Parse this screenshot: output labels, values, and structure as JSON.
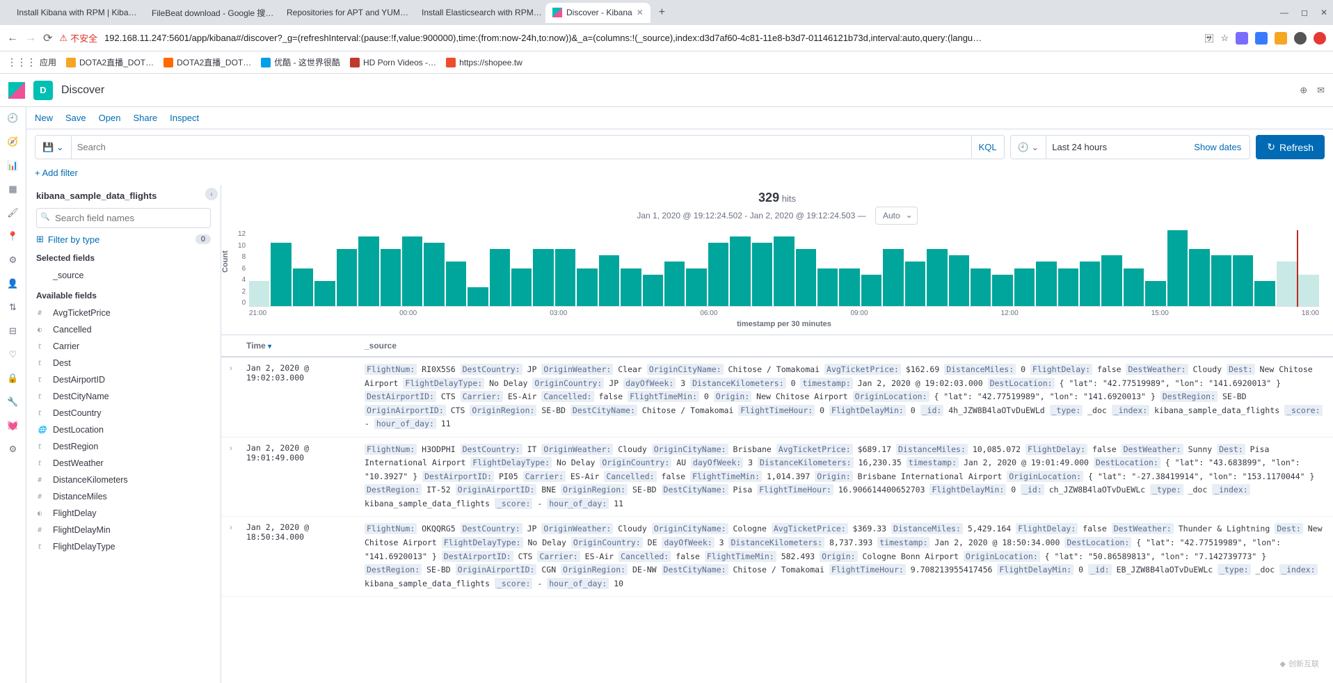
{
  "browser": {
    "tabs": [
      {
        "title": "Install Kibana with RPM | Kiba…",
        "active": false,
        "icon": "elastic"
      },
      {
        "title": "FileBeat download - Google 搜…",
        "active": false,
        "icon": "google"
      },
      {
        "title": "Repositories for APT and YUM…",
        "active": false,
        "icon": "elastic"
      },
      {
        "title": "Install Elasticsearch with RPM…",
        "active": false,
        "icon": "elastic"
      },
      {
        "title": "Discover - Kibana",
        "active": true,
        "icon": "kibana"
      }
    ],
    "url_warn": "不安全",
    "url": "192.168.11.247:5601/app/kibana#/discover?_g=(refreshInterval:(pause:!f,value:900000),time:(from:now-24h,to:now))&_a=(columns:!(_source),index:d3d7af60-4c81-11e8-b3d7-01146121b73d,interval:auto,query:(langu…",
    "bookmarks": [
      {
        "label": "应用",
        "fav": "#5f6368"
      },
      {
        "label": "DOTA2直播_DOT…",
        "fav": "#f5a623"
      },
      {
        "label": "DOTA2直播_DOT…",
        "fav": "#ff6a00"
      },
      {
        "label": "优酷 - 这世界很酷",
        "fav": "#00a0e9"
      },
      {
        "label": "HD Porn Videos -…",
        "fav": "#c0392b"
      },
      {
        "label": "https://shopee.tw",
        "fav": "#ee4d2d"
      }
    ]
  },
  "header": {
    "space": "D",
    "title": "Discover"
  },
  "topmenu": {
    "new": "New",
    "save": "Save",
    "open": "Open",
    "share": "Share",
    "inspect": "Inspect"
  },
  "query": {
    "save_icon": "💾",
    "search_ph": "Search",
    "kql": "KQL",
    "time_icon": "🕘",
    "time_label": "Last 24 hours",
    "show_dates": "Show dates",
    "refresh": "Refresh"
  },
  "filters": {
    "add": "+ Add filter"
  },
  "fields": {
    "index": "kibana_sample_data_flights",
    "search_ph": "Search field names",
    "filter_type": "Filter by type",
    "filter_count": "0",
    "selected_label": "Selected fields",
    "selected": [
      {
        "t": "</>",
        "n": "_source"
      }
    ],
    "available_label": "Available fields",
    "available": [
      {
        "t": "#",
        "n": "AvgTicketPrice"
      },
      {
        "t": "◐",
        "n": "Cancelled"
      },
      {
        "t": "t",
        "n": "Carrier"
      },
      {
        "t": "t",
        "n": "Dest"
      },
      {
        "t": "t",
        "n": "DestAirportID"
      },
      {
        "t": "t",
        "n": "DestCityName"
      },
      {
        "t": "t",
        "n": "DestCountry"
      },
      {
        "t": "🌐",
        "n": "DestLocation"
      },
      {
        "t": "t",
        "n": "DestRegion"
      },
      {
        "t": "t",
        "n": "DestWeather"
      },
      {
        "t": "#",
        "n": "DistanceKilometers"
      },
      {
        "t": "#",
        "n": "DistanceMiles"
      },
      {
        "t": "◐",
        "n": "FlightDelay"
      },
      {
        "t": "#",
        "n": "FlightDelayMin"
      },
      {
        "t": "t",
        "n": "FlightDelayType"
      }
    ]
  },
  "hits": {
    "count": "329",
    "label": "hits",
    "range": "Jan 1, 2020 @ 19:12:24.502 - Jan 2, 2020 @ 19:12:24.503 —",
    "interval": "Auto"
  },
  "chart_data": {
    "type": "bar",
    "ylabel": "Count",
    "xlabel": "timestamp per 30 minutes",
    "ylim": [
      0,
      12
    ],
    "y_ticks": [
      "12",
      "10",
      "8",
      "6",
      "4",
      "2",
      "0"
    ],
    "x_ticks": [
      "21:00",
      "00:00",
      "03:00",
      "06:00",
      "09:00",
      "12:00",
      "15:00",
      "18:00"
    ],
    "values": [
      4,
      10,
      6,
      4,
      9,
      11,
      9,
      11,
      10,
      7,
      3,
      9,
      6,
      9,
      9,
      6,
      8,
      6,
      5,
      7,
      6,
      10,
      11,
      10,
      11,
      9,
      6,
      6,
      5,
      9,
      7,
      9,
      8,
      6,
      5,
      6,
      7,
      6,
      7,
      8,
      6,
      4,
      12,
      9,
      8,
      8,
      4,
      7,
      5
    ]
  },
  "table": {
    "col_time": "Time",
    "col_src": "_source",
    "rows": [
      {
        "time": "Jan 2, 2020 @ 19:02:03.000",
        "kv": [
          [
            "FlightNum:",
            "RI0X5S6"
          ],
          [
            "DestCountry:",
            "JP"
          ],
          [
            "OriginWeather:",
            "Clear"
          ],
          [
            "OriginCityName:",
            "Chitose / Tomakomai"
          ],
          [
            "AvgTicketPrice:",
            "$162.69"
          ],
          [
            "DistanceMiles:",
            "0"
          ],
          [
            "FlightDelay:",
            "false"
          ],
          [
            "DestWeather:",
            "Cloudy"
          ],
          [
            "Dest:",
            "New Chitose Airport"
          ],
          [
            "FlightDelayType:",
            "No Delay"
          ],
          [
            "OriginCountry:",
            "JP"
          ],
          [
            "dayOfWeek:",
            "3"
          ],
          [
            "DistanceKilometers:",
            "0"
          ],
          [
            "timestamp:",
            "Jan 2, 2020 @ 19:02:03.000"
          ],
          [
            "DestLocation:",
            "{ \"lat\": \"42.77519989\", \"lon\": \"141.6920013\" }"
          ],
          [
            "DestAirportID:",
            "CTS"
          ],
          [
            "Carrier:",
            "ES-Air"
          ],
          [
            "Cancelled:",
            "false"
          ],
          [
            "FlightTimeMin:",
            "0"
          ],
          [
            "Origin:",
            "New Chitose Airport"
          ],
          [
            "OriginLocation:",
            "{ \"lat\": \"42.77519989\", \"lon\": \"141.6920013\" }"
          ],
          [
            "DestRegion:",
            "SE-BD"
          ],
          [
            "OriginAirportID:",
            "CTS"
          ],
          [
            "OriginRegion:",
            "SE-BD"
          ],
          [
            "DestCityName:",
            "Chitose / Tomakomai"
          ],
          [
            "FlightTimeHour:",
            "0"
          ],
          [
            "FlightDelayMin:",
            "0"
          ],
          [
            "_id:",
            "4h_JZW8B4laOTvDuEWLd"
          ],
          [
            "_type:",
            "_doc"
          ],
          [
            "_index:",
            "kibana_sample_data_flights"
          ],
          [
            "_score:",
            " - "
          ],
          [
            "hour_of_day:",
            "11"
          ]
        ]
      },
      {
        "time": "Jan 2, 2020 @ 19:01:49.000",
        "kv": [
          [
            "FlightNum:",
            "H3ODPHI"
          ],
          [
            "DestCountry:",
            "IT"
          ],
          [
            "OriginWeather:",
            "Cloudy"
          ],
          [
            "OriginCityName:",
            "Brisbane"
          ],
          [
            "AvgTicketPrice:",
            "$689.17"
          ],
          [
            "DistanceMiles:",
            "10,085.072"
          ],
          [
            "FlightDelay:",
            "false"
          ],
          [
            "DestWeather:",
            "Sunny"
          ],
          [
            "Dest:",
            "Pisa International Airport"
          ],
          [
            "FlightDelayType:",
            "No Delay"
          ],
          [
            "OriginCountry:",
            "AU"
          ],
          [
            "dayOfWeek:",
            "3"
          ],
          [
            "DistanceKilometers:",
            "16,230.35"
          ],
          [
            "timestamp:",
            "Jan 2, 2020 @ 19:01:49.000"
          ],
          [
            "DestLocation:",
            "{ \"lat\": \"43.683899\", \"lon\": \"10.3927\" }"
          ],
          [
            "DestAirportID:",
            "PI05"
          ],
          [
            "Carrier:",
            "ES-Air"
          ],
          [
            "Cancelled:",
            "false"
          ],
          [
            "FlightTimeMin:",
            "1,014.397"
          ],
          [
            "Origin:",
            "Brisbane International Airport"
          ],
          [
            "OriginLocation:",
            "{ \"lat\": \"-27.38419914\", \"lon\": \"153.1170044\" }"
          ],
          [
            "DestRegion:",
            "IT-52"
          ],
          [
            "OriginAirportID:",
            "BNE"
          ],
          [
            "OriginRegion:",
            "SE-BD"
          ],
          [
            "DestCityName:",
            "Pisa"
          ],
          [
            "FlightTimeHour:",
            "16.906614400652703"
          ],
          [
            "FlightDelayMin:",
            "0"
          ],
          [
            "_id:",
            "ch_JZW8B4laOTvDuEWLc"
          ],
          [
            "_type:",
            "_doc"
          ],
          [
            "_index:",
            "kibana_sample_data_flights"
          ],
          [
            "_score:",
            " - "
          ],
          [
            "hour_of_day:",
            "11"
          ]
        ]
      },
      {
        "time": "Jan 2, 2020 @ 18:50:34.000",
        "kv": [
          [
            "FlightNum:",
            "OKQQRG5"
          ],
          [
            "DestCountry:",
            "JP"
          ],
          [
            "OriginWeather:",
            "Cloudy"
          ],
          [
            "OriginCityName:",
            "Cologne"
          ],
          [
            "AvgTicketPrice:",
            "$369.33"
          ],
          [
            "DistanceMiles:",
            "5,429.164"
          ],
          [
            "FlightDelay:",
            "false"
          ],
          [
            "DestWeather:",
            "Thunder & Lightning"
          ],
          [
            "Dest:",
            "New Chitose Airport"
          ],
          [
            "FlightDelayType:",
            "No Delay"
          ],
          [
            "OriginCountry:",
            "DE"
          ],
          [
            "dayOfWeek:",
            "3"
          ],
          [
            "DistanceKilometers:",
            "8,737.393"
          ],
          [
            "timestamp:",
            "Jan 2, 2020 @ 18:50:34.000"
          ],
          [
            "DestLocation:",
            "{ \"lat\": \"42.77519989\", \"lon\": \"141.6920013\" }"
          ],
          [
            "DestAirportID:",
            "CTS"
          ],
          [
            "Carrier:",
            "ES-Air"
          ],
          [
            "Cancelled:",
            "false"
          ],
          [
            "FlightTimeMin:",
            "582.493"
          ],
          [
            "Origin:",
            "Cologne Bonn Airport"
          ],
          [
            "OriginLocation:",
            "{ \"lat\": \"50.86589813\", \"lon\": \"7.142739773\" }"
          ],
          [
            "DestRegion:",
            "SE-BD"
          ],
          [
            "OriginAirportID:",
            "CGN"
          ],
          [
            "OriginRegion:",
            "DE-NW"
          ],
          [
            "DestCityName:",
            "Chitose / Tomakomai"
          ],
          [
            "FlightTimeHour:",
            "9.708213955417456"
          ],
          [
            "FlightDelayMin:",
            "0"
          ],
          [
            "_id:",
            "EB_JZW8B4laOTvDuEWLc"
          ],
          [
            "_type:",
            "_doc"
          ],
          [
            "_index:",
            "kibana_sample_data_flights"
          ],
          [
            "_score:",
            " - "
          ],
          [
            "hour_of_day:",
            "10"
          ]
        ]
      }
    ]
  },
  "watermark": "创新互联"
}
